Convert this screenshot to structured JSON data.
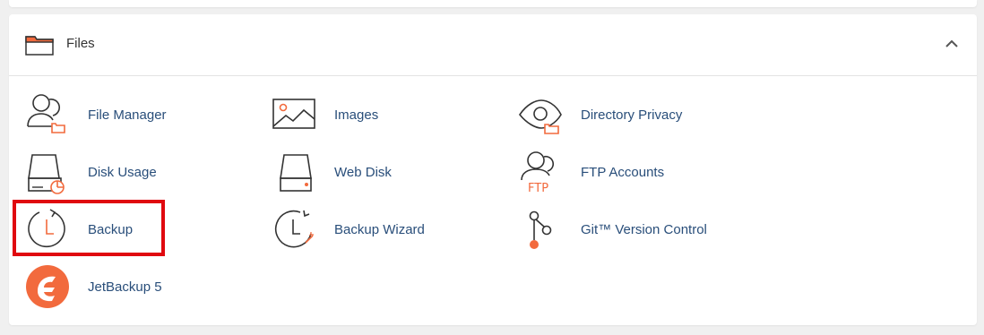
{
  "section": {
    "title": "Files",
    "icon": "folder-icon",
    "collapse_icon": "chevron-up-icon"
  },
  "items": [
    {
      "label": "File Manager",
      "icon": "file-manager-icon"
    },
    {
      "label": "Images",
      "icon": "images-icon"
    },
    {
      "label": "Directory Privacy",
      "icon": "directory-privacy-icon"
    },
    {
      "label": "Disk Usage",
      "icon": "disk-usage-icon"
    },
    {
      "label": "Web Disk",
      "icon": "web-disk-icon"
    },
    {
      "label": "FTP Accounts",
      "icon": "ftp-accounts-icon"
    },
    {
      "label": "Backup",
      "icon": "backup-icon"
    },
    {
      "label": "Backup Wizard",
      "icon": "backup-wizard-icon"
    },
    {
      "label": "Git™ Version Control",
      "icon": "git-icon"
    },
    {
      "label": "JetBackup 5",
      "icon": "jetbackup-icon"
    }
  ],
  "colors": {
    "accent": "#f26a3d",
    "link": "#294e7a",
    "highlight": "#e0090f"
  }
}
